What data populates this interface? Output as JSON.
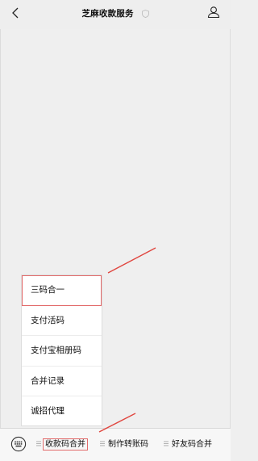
{
  "header": {
    "title": "芝麻收款服务"
  },
  "menu": {
    "items": [
      {
        "label": "三码合一"
      },
      {
        "label": "支付活码"
      },
      {
        "label": "支付宝相册码"
      },
      {
        "label": "合并记录"
      },
      {
        "label": "诚招代理"
      }
    ]
  },
  "bottom_bar": {
    "tabs": [
      {
        "label": "收款码合并"
      },
      {
        "label": "制作转账码"
      },
      {
        "label": "好友码合并"
      }
    ]
  },
  "colors": {
    "background": "#efefef",
    "highlight": "#e26a6a"
  }
}
